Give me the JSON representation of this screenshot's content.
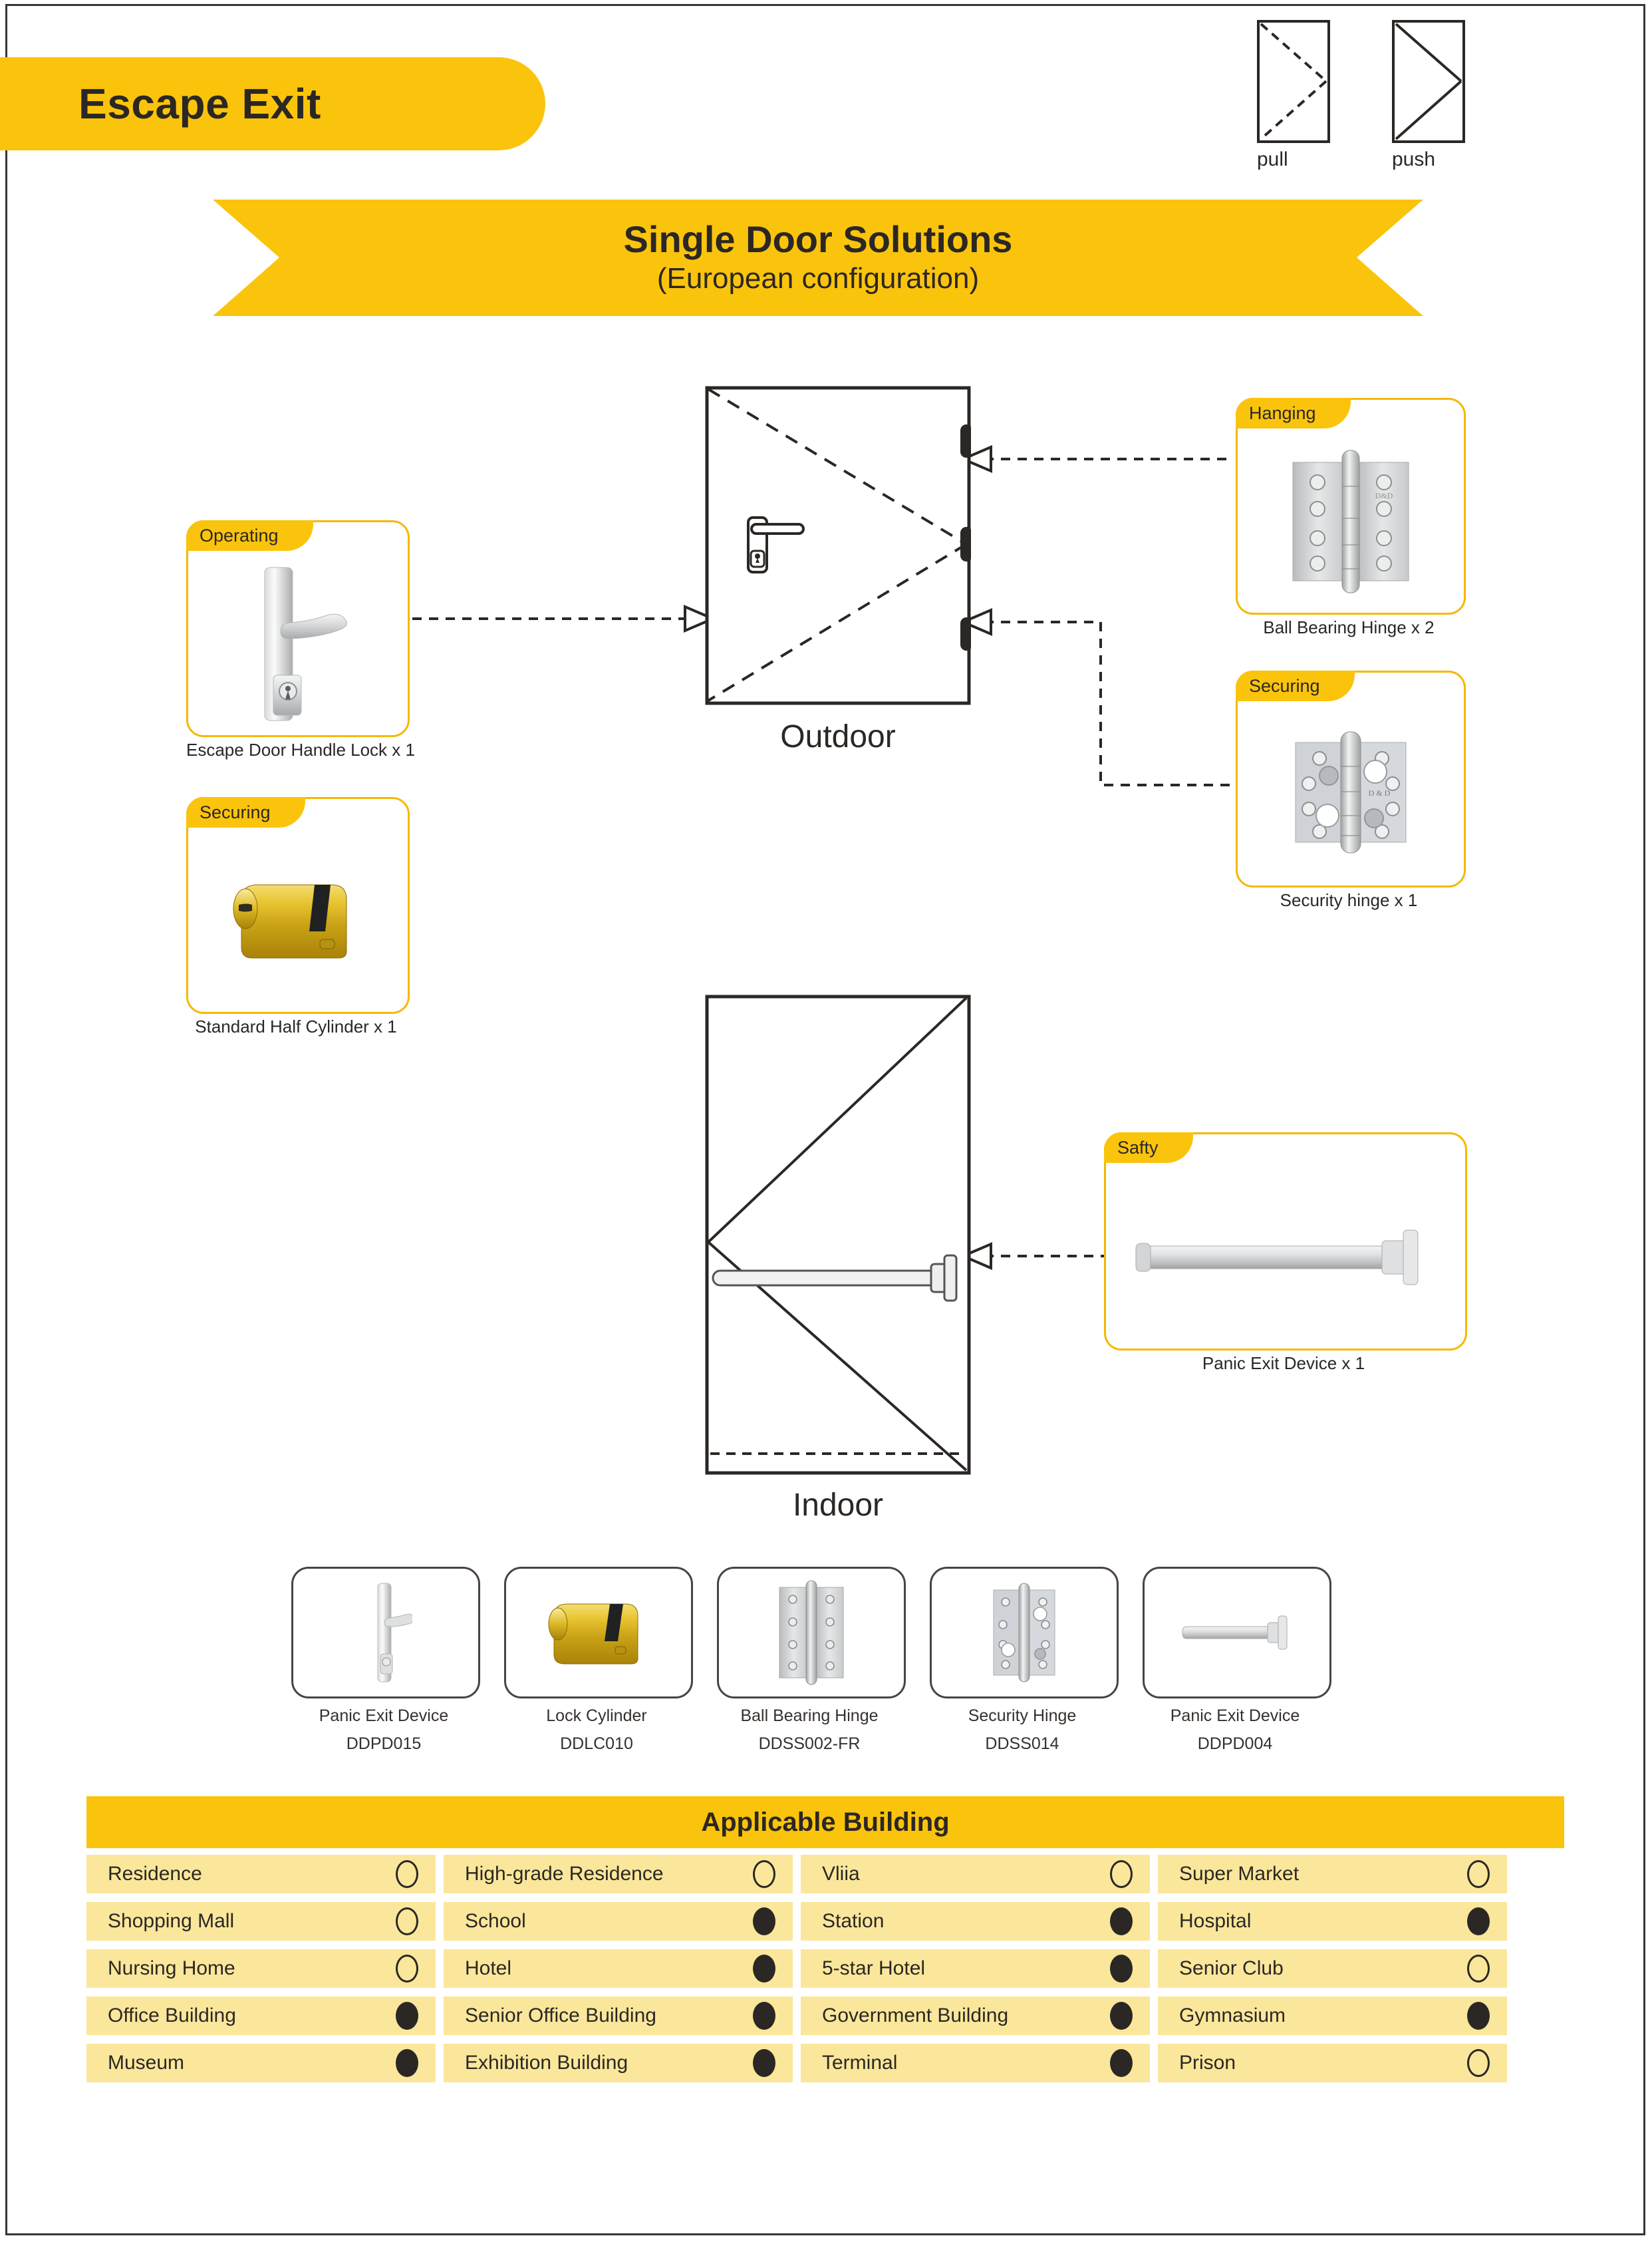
{
  "page": {
    "tab_label": "Escape Exit",
    "banner_title": "Single Door Solutions",
    "banner_subtitle": "(European configuration)"
  },
  "door_icons": [
    {
      "name": "pull-icon",
      "label": "pull",
      "style": "dashed"
    },
    {
      "name": "push-icon",
      "label": "push",
      "style": "solid"
    }
  ],
  "door_views": {
    "outdoor_label": "Outdoor",
    "indoor_label": "Indoor"
  },
  "callouts": [
    {
      "id": "escape-door-handle-lock",
      "tag": "Operating",
      "caption": "Escape Door Handle Lock x 1"
    },
    {
      "id": "standard-half-cylinder",
      "tag": "Securing",
      "caption": "Standard Half Cylinder x 1"
    },
    {
      "id": "ball-bearing-hinge",
      "tag": "Hanging",
      "caption": "Ball Bearing Hinge x 2"
    },
    {
      "id": "security-hinge",
      "tag": "Securing",
      "caption": "Security hinge x 1"
    },
    {
      "id": "panic-exit-device",
      "tag": "Safty",
      "caption": "Panic  Exit  Device x 1"
    }
  ],
  "thumbnails": [
    {
      "name": "Panic Exit Device",
      "code": "DDPD015"
    },
    {
      "name": "Lock Cylinder",
      "code": "DDLC010"
    },
    {
      "name": "Ball Bearing Hinge",
      "code": "DDSS002-FR"
    },
    {
      "name": "Security Hinge",
      "code": "DDSS014"
    },
    {
      "name": "Panic Exit Device",
      "code": "DDPD004"
    }
  ],
  "applicable_building": {
    "title": "Applicable Building",
    "rows": [
      [
        {
          "label": "Residence",
          "marked": false
        },
        {
          "label": "High-grade Residence",
          "marked": false
        },
        {
          "label": "Vliia",
          "marked": false
        },
        {
          "label": "Super Market",
          "marked": false
        }
      ],
      [
        {
          "label": "Shopping Mall",
          "marked": false
        },
        {
          "label": "School",
          "marked": true
        },
        {
          "label": "Station",
          "marked": true
        },
        {
          "label": "Hospital",
          "marked": true
        }
      ],
      [
        {
          "label": "Nursing Home",
          "marked": false
        },
        {
          "label": "Hotel",
          "marked": true
        },
        {
          "label": "5-star Hotel",
          "marked": true
        },
        {
          "label": "Senior Club",
          "marked": false
        }
      ],
      [
        {
          "label": "Office Building",
          "marked": true
        },
        {
          "label": "Senior Office Building",
          "marked": true
        },
        {
          "label": "Government Building",
          "marked": true
        },
        {
          "label": "Gymnasium",
          "marked": true
        }
      ],
      [
        {
          "label": "Museum",
          "marked": true
        },
        {
          "label": "Exhibition Building",
          "marked": true
        },
        {
          "label": "Terminal",
          "marked": true
        },
        {
          "label": "Prison",
          "marked": false
        }
      ]
    ]
  },
  "colors": {
    "accent": "#fbc40c",
    "accent_border": "#f5b800",
    "row_bg": "#fbe79b",
    "ink": "#2b2724"
  }
}
